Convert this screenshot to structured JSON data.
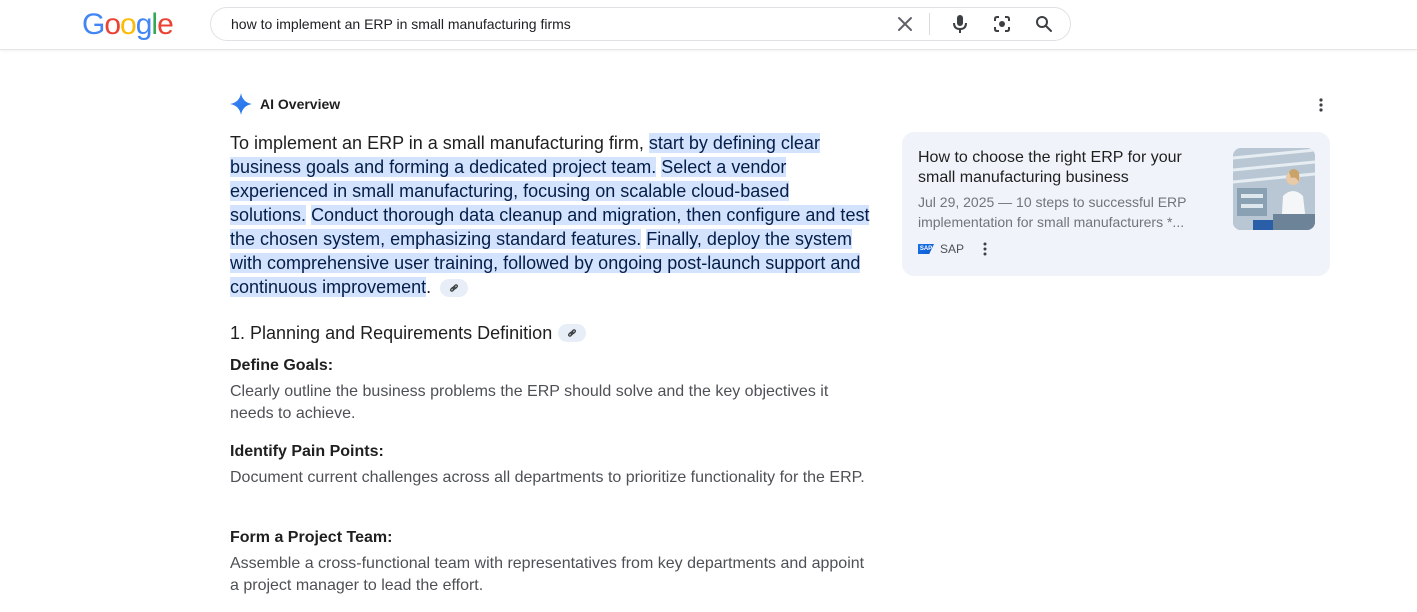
{
  "header": {
    "logo_letters": [
      "G",
      "o",
      "o",
      "g",
      "l",
      "e"
    ],
    "logo_colors": [
      "#4285F4",
      "#EA4335",
      "#FBBC05",
      "#4285F4",
      "#34A853",
      "#EA4335"
    ],
    "search_value": "how to implement an ERP in small manufacturing firms",
    "icons": [
      "clear-icon",
      "microphone-icon",
      "lens-icon",
      "search-icon"
    ]
  },
  "ai_overview": {
    "title": "AI Overview",
    "summary_intro": "To implement an ERP in a small manufacturing firm, ",
    "summary_highlights": [
      "start by defining clear business goals and forming a dedicated project team.",
      "Select a vendor experienced in small manufacturing, focusing on scalable cloud-based solutions.",
      "Conduct thorough data cleanup and migration, then configure and test the chosen system, emphasizing standard features.",
      "Finally, deploy the system with comprehensive user training, followed by ongoing post-launch support and continuous improvement"
    ],
    "summary_end": ".",
    "section_title": "1. Planning and Requirements Definition",
    "items": [
      {
        "label": "Define Goals:",
        "desc": "Clearly outline the business problems the ERP should solve and the key objectives it needs to achieve."
      },
      {
        "label": "Identify Pain Points:",
        "desc": "Document current challenges across all departments to prioritize functionality for the ERP."
      },
      {
        "label": "Form a Project Team:",
        "desc": "Assemble a cross-functional team with representatives from key departments and appoint a project manager to lead the effort."
      }
    ]
  },
  "source_card": {
    "title": "How to choose the right ERP for your small manufacturing business",
    "snippet": "Jul 29, 2025 — 10 steps to successful ERP implementation for small manufacturers *...",
    "source_name": "SAP",
    "logo_text": "SAP"
  },
  "colors": {
    "highlight": "#d3e3fd",
    "card_bg": "#f0f4fa",
    "accent_blue": "#1a73e8"
  }
}
